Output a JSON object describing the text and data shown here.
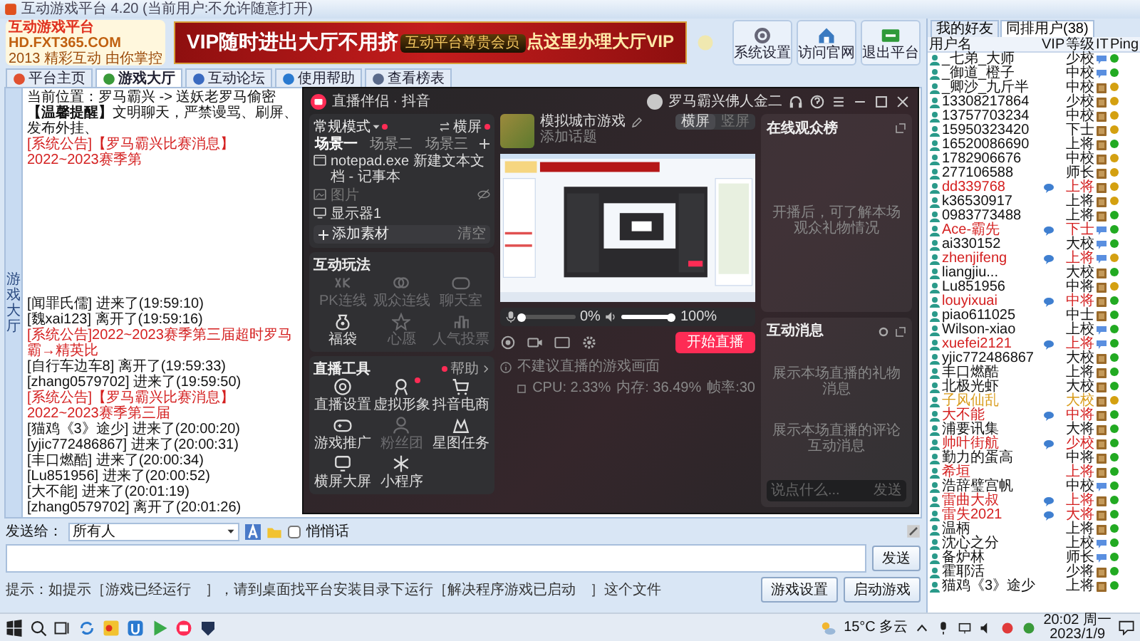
{
  "window": {
    "title": "互动游戏平台 4.20 (当前用户:不允许随意打开)"
  },
  "banner": {
    "logo_title": "互动游戏平台",
    "logo_url": "HD.FXT365.COM",
    "logo_slogan": "2013 精彩互动 由你掌控",
    "vip_left": "VIP随时进出大厅不用挤",
    "vip_emblem": "互动平台尊贵会员",
    "vip_right": "点这里办理大厅VIP"
  },
  "system_buttons": [
    "系统设置",
    "访问官网",
    "退出平台"
  ],
  "nav_tabs": [
    {
      "label": "平台主页",
      "selected": false
    },
    {
      "label": "游戏大厅",
      "selected": true
    },
    {
      "label": "互动论坛",
      "selected": false
    },
    {
      "label": "使用帮助",
      "selected": false
    },
    {
      "label": "查看榜表",
      "selected": false
    }
  ],
  "side_tab": "游戏大厅",
  "room": {
    "location": "当前位置：罗马霸兴 -> 送妖老罗马偷密",
    "notice": "**【温馨提醒】**文明聊天，严禁谩骂、刷屏、发布外挂、",
    "announcement": "[系统公告]【罗马霸兴比赛消息】2022~2023赛季第"
  },
  "chat": [
    {
      "kind": "user",
      "text": "[闻罪氏儒] 进来了(19:59:10)"
    },
    {
      "kind": "user",
      "text": "[魏xai123] 离开了(19:59:16)"
    },
    {
      "kind": "system",
      "text": "[系统公告]2022~2023赛季第三届超时罗马霸→精英比"
    },
    {
      "kind": "user",
      "text": "[自行车边车8] 离开了(19:59:33)"
    },
    {
      "kind": "user",
      "text": "[zhang0579702] 进来了(19:59:50)"
    },
    {
      "kind": "system",
      "text": "[系统公告]【罗马霸兴比赛消息】2022~2023赛季第三届"
    },
    {
      "kind": "user",
      "text": "[猫鸡《3》途少] 进来了(20:00:20)"
    },
    {
      "kind": "user",
      "text": "[yjic772486867] 进来了(20:00:31)"
    },
    {
      "kind": "user",
      "text": "[丰口燃酷] 进来了(20:00:34)"
    },
    {
      "kind": "user",
      "text": "[Lu851956] 进来了(20:00:52)"
    },
    {
      "kind": "user",
      "text": "[大不能] 进来了(20:01:19)"
    },
    {
      "kind": "user",
      "text": "[zhang0579702] 离开了(20:01:26)"
    }
  ],
  "send_bar": {
    "label": "发送给：",
    "recipient": "所有人",
    "whisper": {
      "label": "悄悄话",
      "checked": false
    },
    "send_button": "发送",
    "hint": "提示：如提示［游戏已经运行　］，请到桌面找平台安装目录下运行［解决程序游戏已启动　］这个文件",
    "buttons": [
      "游戏设置",
      "启动游戏"
    ]
  },
  "live_app": {
    "title": "直播伴侣 · 抖音",
    "account": "罗马霸兴佛人金二",
    "mode": {
      "label": "常规模式",
      "badge": true
    },
    "orientation_switch": {
      "label": "横屏",
      "badge": true
    },
    "scenes": [
      {
        "label": "场景一",
        "selected": true
      },
      {
        "label": "场景二",
        "selected": false
      },
      {
        "label": "场景三",
        "selected": false
      }
    ],
    "sources": [
      {
        "label": "notepad.exe 新建文本文档 - 记事本",
        "visible": true
      },
      {
        "label": "图片",
        "visible": false
      },
      {
        "label": "显示器1",
        "visible": true
      }
    ],
    "add_source": "添加素材",
    "clear": "清空",
    "interact_title": "互动玩法",
    "interact": [
      {
        "label": "PK连线",
        "enabled": false
      },
      {
        "label": "观众连线",
        "enabled": false
      },
      {
        "label": "聊天室",
        "enabled": false
      },
      {
        "label": "福袋",
        "enabled": true
      },
      {
        "label": "心愿",
        "enabled": false
      },
      {
        "label": "人气投票",
        "enabled": false
      }
    ],
    "tools_title": "直播工具",
    "tools_help": "帮助",
    "tools": [
      {
        "label": "直播设置",
        "enabled": true,
        "badge": false
      },
      {
        "label": "虚拟形象",
        "enabled": true,
        "badge": true
      },
      {
        "label": "抖音电商",
        "enabled": true,
        "badge": false
      },
      {
        "label": "游戏推广",
        "enabled": true,
        "badge": false
      },
      {
        "label": "粉丝团",
        "enabled": false,
        "badge": false
      },
      {
        "label": "星图任务",
        "enabled": true,
        "badge": false
      },
      {
        "label": "横屏大屏",
        "enabled": true,
        "badge": false
      },
      {
        "label": "小程序",
        "enabled": true,
        "badge": false
      }
    ],
    "game": {
      "title": "模拟城市游戏",
      "topic": "添加话题"
    },
    "view_modes": [
      {
        "label": "横屏",
        "selected": true
      },
      {
        "label": "竖屏",
        "selected": false
      }
    ],
    "mic": {
      "level": 0,
      "reading": "0%"
    },
    "speaker": {
      "level": 1,
      "reading": "100%"
    },
    "start_button": "开始直播",
    "hint": "不建议直播的游戏画面",
    "stats": [
      "CPU: 2.33%",
      "内存: 36.49%",
      "帧率:30"
    ],
    "audience": {
      "title": "在线观众榜",
      "empty": "开播后，可了解本场观众礼物情况"
    },
    "messages": {
      "title": "互动消息",
      "gift_empty": "展示本场直播的礼物消息",
      "comment_empty": "展示本场直播的评论互动消息",
      "placeholder": "说点什么...",
      "send": "发送"
    }
  },
  "user_panel": {
    "tabs": [
      {
        "label": "我的好友",
        "selected": false
      },
      {
        "label": "同排用户(38)",
        "selected": true
      }
    ],
    "columns": [
      "用户名",
      "VIP",
      "等级",
      "IT",
      "Ping"
    ],
    "users": [
      {
        "name": "_七弟_大师",
        "vip": false,
        "rank": "少校",
        "color": "#111111",
        "kind": "bubble",
        "ping": {
          "color": "#22aa22"
        }
      },
      {
        "name": "_御道_橙子",
        "vip": false,
        "rank": "中校",
        "color": "#111111",
        "kind": "bubble",
        "ping": {
          "color": "#22aa22"
        }
      },
      {
        "name": "_卿沙_九斤半",
        "vip": false,
        "rank": "中校",
        "color": "#111111",
        "kind": "box",
        "ping": {
          "color": "#d4a010"
        }
      },
      {
        "name": "13308217864",
        "vip": false,
        "rank": "少校",
        "color": "#111111",
        "kind": "box",
        "ping": {
          "color": "#d4a010"
        }
      },
      {
        "name": "13757703234",
        "vip": false,
        "rank": "中校",
        "color": "#111111",
        "kind": "box",
        "ping": {
          "color": "#d4a010"
        }
      },
      {
        "name": "15950323420",
        "vip": false,
        "rank": "下士",
        "color": "#111111",
        "kind": "box",
        "ping": {
          "color": "#d4a010"
        }
      },
      {
        "name": "16520086690",
        "vip": false,
        "rank": "上将",
        "color": "#111111",
        "kind": "box",
        "ping": {
          "color": "#22aa22"
        }
      },
      {
        "name": "1782906676",
        "vip": false,
        "rank": "中校",
        "color": "#111111",
        "kind": "box",
        "ping": {
          "color": "#d4a010"
        }
      },
      {
        "name": "277106588",
        "vip": false,
        "rank": "师长",
        "color": "#111111",
        "kind": "box",
        "ping": {
          "color": "#d4a010"
        }
      },
      {
        "name": "dd339768",
        "vip": true,
        "rank": "上将",
        "color": "#d42020",
        "kind": "box",
        "ping": {
          "color": "#d4a010"
        }
      },
      {
        "name": "k36530917",
        "vip": false,
        "rank": "上将",
        "color": "#111111",
        "kind": "box",
        "ping": {
          "color": "#d4a010"
        }
      },
      {
        "name": "0983773488",
        "vip": false,
        "rank": "上将",
        "color": "#111111",
        "kind": "box",
        "ping": {
          "color": "#22aa22"
        }
      },
      {
        "name": "Ace-霸先",
        "vip": true,
        "rank": "下士",
        "color": "#d42020",
        "kind": "bubble",
        "ping": {
          "color": "#22aa22"
        }
      },
      {
        "name": "ai330152",
        "vip": false,
        "rank": "大校",
        "color": "#111111",
        "kind": "bubble",
        "ping": {
          "color": "#22aa22"
        }
      },
      {
        "name": "zhenjifeng",
        "vip": true,
        "rank": "上将",
        "color": "#d42020",
        "kind": "bubble",
        "ping": {
          "color": "#d4a010"
        }
      },
      {
        "name": "liangjiu...",
        "vip": false,
        "rank": "大校",
        "color": "#111111",
        "kind": "box",
        "ping": {
          "color": "#22aa22"
        }
      },
      {
        "name": "Lu851956",
        "vip": false,
        "rank": "中将",
        "color": "#111111",
        "kind": "box",
        "ping": {
          "color": "#d4a010"
        }
      },
      {
        "name": "louyixuai",
        "vip": true,
        "rank": "中将",
        "color": "#d42020",
        "kind": "box",
        "ping": {
          "color": "#22aa22"
        }
      },
      {
        "name": "piao611025",
        "vip": false,
        "rank": "中士",
        "color": "#111111",
        "kind": "box",
        "ping": {
          "color": "#22aa22"
        }
      },
      {
        "name": "Wilson-xiao",
        "vip": false,
        "rank": "上校",
        "color": "#111111",
        "kind": "bubble",
        "ping": {
          "color": "#22aa22"
        }
      },
      {
        "name": "xuefei2121",
        "vip": true,
        "rank": "上将",
        "color": "#d42020",
        "kind": "bubble",
        "ping": {
          "color": "#22aa22"
        }
      },
      {
        "name": "yjic772486867",
        "vip": false,
        "rank": "大校",
        "color": "#111111",
        "kind": "box",
        "ping": {
          "color": "#22aa22"
        }
      },
      {
        "name": "丰口燃酷",
        "vip": false,
        "rank": "上将",
        "color": "#111111",
        "kind": "box",
        "ping": {
          "color": "#22aa22"
        }
      },
      {
        "name": "北极光虾",
        "vip": false,
        "rank": "大校",
        "color": "#111111",
        "kind": "box",
        "ping": {
          "color": "#22aa22"
        }
      },
      {
        "name": "子风仙乱",
        "vip": false,
        "rank": "大校",
        "color": "#d89a18",
        "kind": "box",
        "ping": {
          "color": "#d4a010"
        }
      },
      {
        "name": "大不能",
        "vip": true,
        "rank": "中将",
        "color": "#d42020",
        "kind": "box",
        "ping": {
          "color": "#22aa22"
        }
      },
      {
        "name": "浦要讯集",
        "vip": false,
        "rank": "大将",
        "color": "#111111",
        "kind": "box",
        "ping": {
          "color": "#22aa22"
        }
      },
      {
        "name": "帅叶街航",
        "vip": true,
        "rank": "少校",
        "color": "#d42020",
        "kind": "box",
        "ping": {
          "color": "#22aa22"
        }
      },
      {
        "name": "勤力的蛋高",
        "vip": false,
        "rank": "中将",
        "color": "#111111",
        "kind": "box",
        "ping": {
          "color": "#22aa22"
        }
      },
      {
        "name": "希垣",
        "vip": false,
        "rank": "上将",
        "color": "#d42020",
        "kind": "box",
        "ping": {
          "color": "#22aa22"
        }
      },
      {
        "name": "浩辞璧宫帆",
        "vip": false,
        "rank": "中校",
        "color": "#111111",
        "kind": "bubble",
        "ping": {
          "color": "#22aa22"
        }
      },
      {
        "name": "雷曲大叔",
        "vip": true,
        "rank": "上将",
        "color": "#d42020",
        "kind": "box",
        "ping": {
          "color": "#22aa22"
        }
      },
      {
        "name": "雷失2021",
        "vip": true,
        "rank": "大将",
        "color": "#d42020",
        "kind": "box",
        "ping": {
          "color": "#22aa22"
        }
      },
      {
        "name": "温柄",
        "vip": false,
        "rank": "上将",
        "color": "#111111",
        "kind": "box",
        "ping": {
          "color": "#22aa22"
        }
      },
      {
        "name": "沈心之分",
        "vip": false,
        "rank": "上校",
        "color": "#111111",
        "kind": "bubble",
        "ping": {
          "color": "#22aa22"
        }
      },
      {
        "name": "备炉林",
        "vip": false,
        "rank": "师长",
        "color": "#111111",
        "kind": "bubble",
        "ping": {
          "color": "#22aa22"
        }
      },
      {
        "name": "霍耶活",
        "vip": false,
        "rank": "少将",
        "color": "#111111",
        "kind": "box",
        "ping": {
          "color": "#22aa22"
        }
      },
      {
        "name": "猫鸡《3》途少",
        "vip": false,
        "rank": "上将",
        "color": "#111111",
        "kind": "box",
        "ping": {
          "color": "#22aa22"
        }
      }
    ]
  },
  "taskbar": {
    "weather": "15°C 多云",
    "time": "20:02 周一",
    "date": "2023/1/9"
  }
}
